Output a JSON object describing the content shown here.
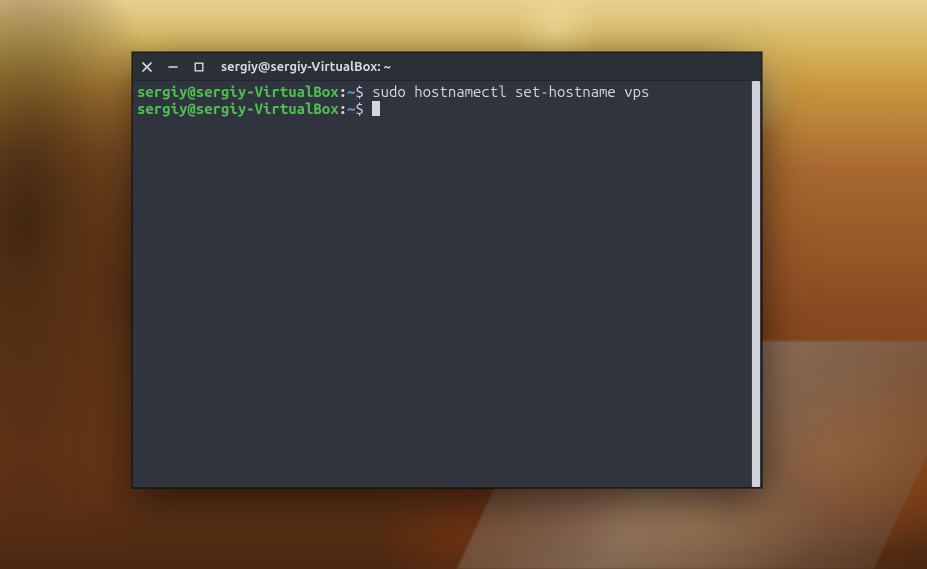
{
  "window": {
    "title": "sergiy@sergiy-VirtualBox: ~"
  },
  "terminal": {
    "lines": [
      {
        "user_host": "sergiy@sergiy-VirtualBox",
        "colon": ":",
        "path": "~",
        "sigil": "$ ",
        "command": "sudo hostnamectl set-hostname vps"
      },
      {
        "user_host": "sergiy@sergiy-VirtualBox",
        "colon": ":",
        "path": "~",
        "sigil": "$ ",
        "command": ""
      }
    ]
  },
  "icons": {
    "close": "close-icon",
    "minimize": "minimize-icon",
    "maximize": "maximize-icon"
  }
}
